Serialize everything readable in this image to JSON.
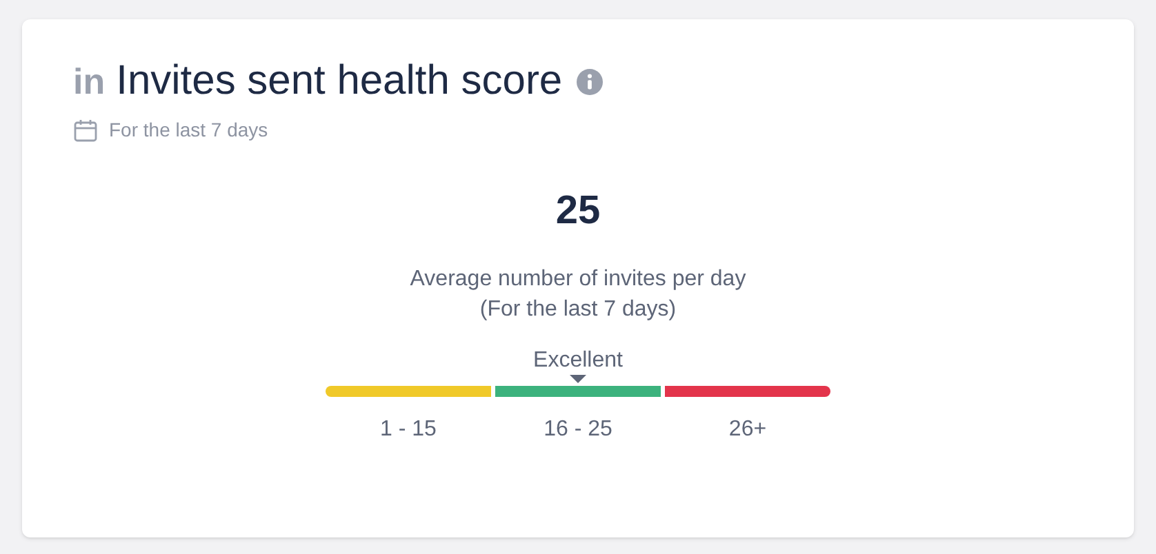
{
  "card": {
    "logo": "in",
    "title": "Invites sent health score",
    "period": "For the last 7 days"
  },
  "score": {
    "value": "25",
    "caption_line_1": "Average number of invites per day",
    "caption_line_2": "(For the last 7 days)",
    "rating": "Excellent"
  },
  "segments": [
    {
      "label": "1 - 15",
      "color": "#f0c929",
      "selected": false
    },
    {
      "label": "16 - 25",
      "color": "#3cb27d",
      "selected": true
    },
    {
      "label": "26+",
      "color": "#e3344b",
      "selected": false
    }
  ]
}
